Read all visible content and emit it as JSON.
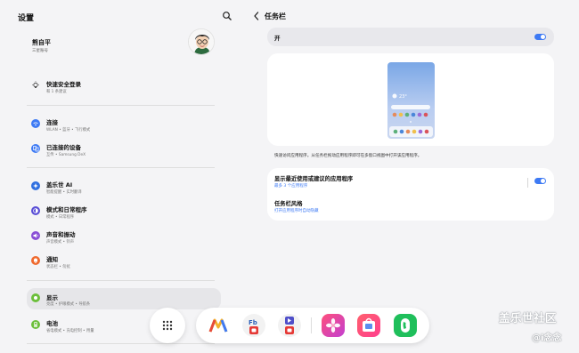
{
  "left": {
    "title": "设置",
    "account": {
      "name": "熊自平",
      "subtitle": "三星账号"
    },
    "items": [
      {
        "title": "快速安全登录",
        "subtitle": "和 1 条建议",
        "icon": "lightbulb-icon",
        "color": "#ffffff"
      },
      {
        "title": "连接",
        "subtitle": "WLAN • 蓝牙 • 飞行模式",
        "icon": "wifi-icon",
        "color": "#3e7af4"
      },
      {
        "title": "已连接的设备",
        "subtitle": "互传 • Samsung DeX",
        "icon": "devices-icon",
        "color": "#3e7af4"
      },
      {
        "title": "盖乐世 AI",
        "subtitle": "智能提醒 • 实时翻译",
        "icon": "ai-icon",
        "color": "#2f6fe0"
      },
      {
        "title": "模式和日常程序",
        "subtitle": "模式 • 日常程序",
        "icon": "mode-icon",
        "color": "#5a4fd6"
      },
      {
        "title": "声音和振动",
        "subtitle": "声音模式 • 铃声",
        "icon": "sound-icon",
        "color": "#8a4fd6"
      },
      {
        "title": "通知",
        "subtitle": "状态栏 • 勿扰",
        "icon": "bell-icon",
        "color": "#ef6a2f"
      },
      {
        "title": "显示",
        "subtitle": "亮度 • 护眼模式 • 导航条",
        "icon": "display-icon",
        "color": "#6cbf3b"
      },
      {
        "title": "电池",
        "subtitle": "省电模式 • 充电控制 • 用量",
        "icon": "battery-icon",
        "color": "#6cbf3b"
      }
    ]
  },
  "right": {
    "title": "任务栏",
    "on_label": "开",
    "preview_time": "23°",
    "description": "快速访问应用程序。从任务栏拖动应用程序即可在多窗口视图中打开该应用程序。",
    "options": [
      {
        "title": "显示最近使用或建议的应用程序",
        "subtitle": "最多 3 个应用程序"
      },
      {
        "title": "任务栏风格",
        "subtitle": "打开应用程序时自动隐藏"
      }
    ]
  },
  "dock": {
    "apps": [
      "maps-app-icon",
      "office-app-icon",
      "video-app-icon",
      "gallery-app-icon",
      "store-app-icon",
      "phone-app-icon"
    ]
  },
  "watermark": {
    "site": "盖乐世社区",
    "user": "@i念念"
  },
  "colors": {
    "accent": "#3e7af4",
    "background": "#f4f4f6"
  }
}
